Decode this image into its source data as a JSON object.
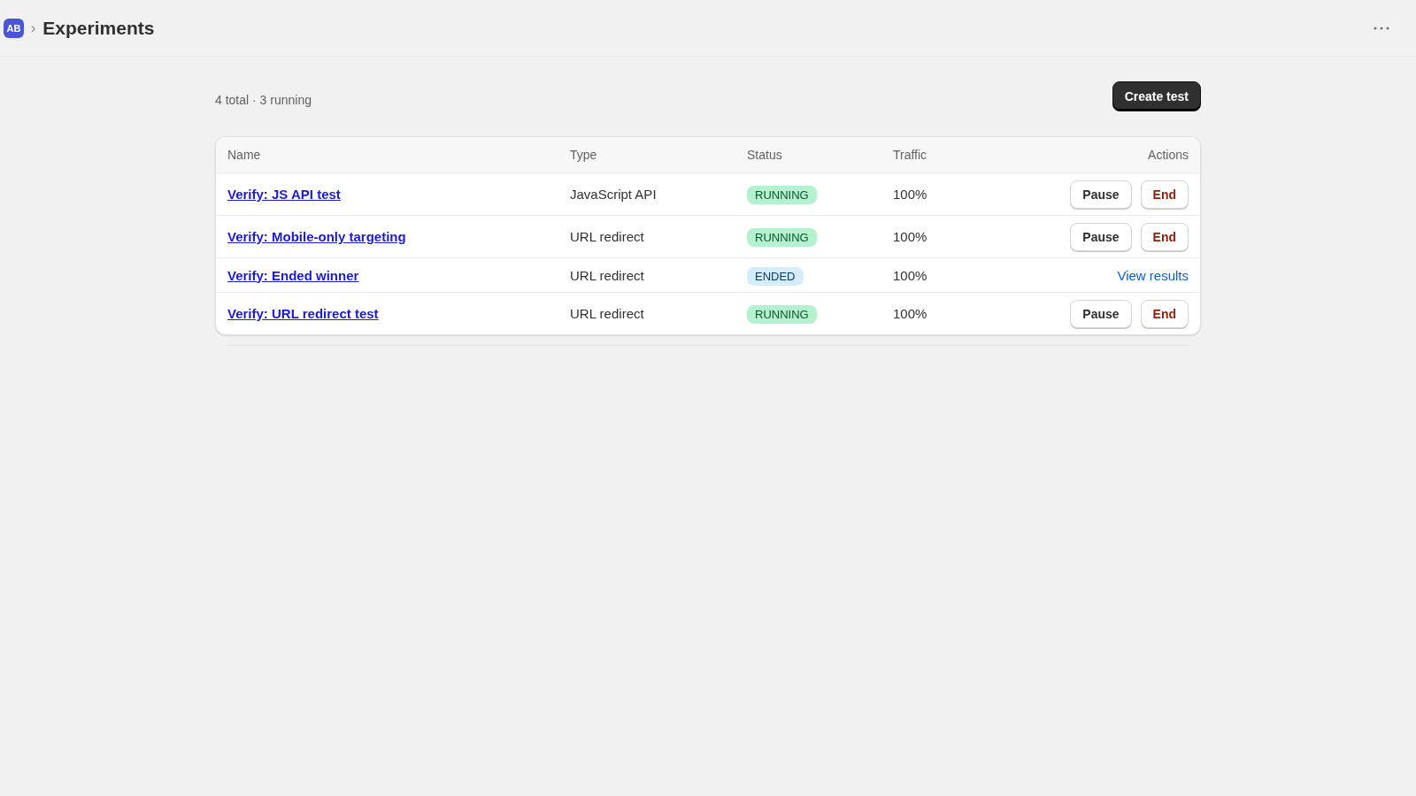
{
  "header": {
    "app_badge": "AB",
    "separator": "›",
    "title": "Experiments"
  },
  "summary": "4 total · 3 running",
  "create_button": "Create test",
  "table": {
    "columns": [
      "Name",
      "Type",
      "Status",
      "Traffic",
      "Actions"
    ],
    "rows": [
      {
        "name": "Verify: JS API test",
        "type": "JavaScript API",
        "status": {
          "label": "RUNNING",
          "kind": "running"
        },
        "traffic": "100%",
        "actions": [
          {
            "label": "Pause",
            "kind": "button"
          },
          {
            "label": "End",
            "kind": "danger"
          }
        ]
      },
      {
        "name": "Verify: Mobile-only targeting",
        "type": "URL redirect",
        "status": {
          "label": "RUNNING",
          "kind": "running"
        },
        "traffic": "100%",
        "actions": [
          {
            "label": "Pause",
            "kind": "button"
          },
          {
            "label": "End",
            "kind": "danger"
          }
        ]
      },
      {
        "name": "Verify: Ended winner",
        "type": "URL redirect",
        "status": {
          "label": "ENDED",
          "kind": "ended"
        },
        "traffic": "100%",
        "actions": [
          {
            "label": "View results",
            "kind": "link"
          }
        ]
      },
      {
        "name": "Verify: URL redirect test",
        "type": "URL redirect",
        "status": {
          "label": "RUNNING",
          "kind": "running"
        },
        "traffic": "100%",
        "actions": [
          {
            "label": "Pause",
            "kind": "button"
          },
          {
            "label": "End",
            "kind": "danger"
          }
        ]
      }
    ]
  }
}
